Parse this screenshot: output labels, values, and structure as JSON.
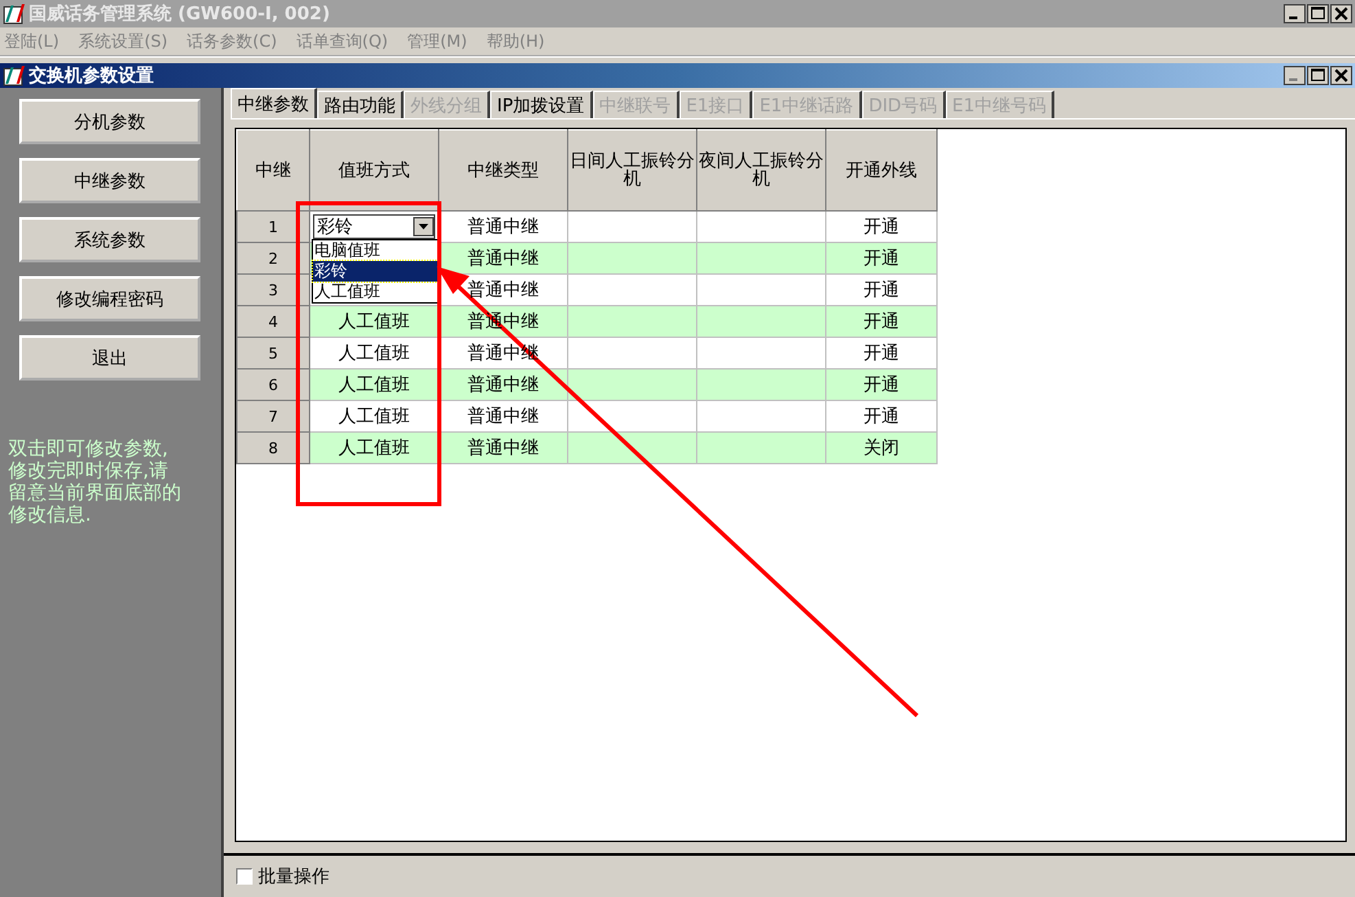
{
  "window": {
    "title": "国威话务管理系统 (GW600-I, 002)"
  },
  "menu": [
    "登陆(L)",
    "系统设置(S)",
    "话务参数(C)",
    "话单查询(Q)",
    "管理(M)",
    "帮助(H)"
  ],
  "child_window": {
    "title": "交换机参数设置"
  },
  "sidebar": {
    "buttons": [
      "分机参数",
      "中继参数",
      "系统参数",
      "修改编程密码",
      "退出"
    ],
    "help_lines": [
      "双击即可修改参数,",
      "修改完即时保存,请",
      "留意当前界面底部的",
      "修改信息."
    ]
  },
  "tabs": [
    {
      "label": "中继参数",
      "selected": true,
      "disabled": false
    },
    {
      "label": "路由功能",
      "selected": false,
      "disabled": false
    },
    {
      "label": "外线分组",
      "selected": false,
      "disabled": true
    },
    {
      "label": "IP加拨设置",
      "selected": false,
      "disabled": false
    },
    {
      "label": "中继联号",
      "selected": false,
      "disabled": true
    },
    {
      "label": "E1接口",
      "selected": false,
      "disabled": true
    },
    {
      "label": "E1中继话路",
      "selected": false,
      "disabled": true
    },
    {
      "label": "DID号码",
      "selected": false,
      "disabled": true
    },
    {
      "label": "E1中继号码",
      "selected": false,
      "disabled": true
    }
  ],
  "table": {
    "columns": [
      "中继",
      "值班方式",
      "中继类型",
      "日间人工振铃分机",
      "夜间人工振铃分机",
      "开通外线"
    ],
    "rows": [
      {
        "trunk": "1",
        "duty": "彩铃",
        "type": "普通中继",
        "outside": "开通"
      },
      {
        "trunk": "2",
        "type": "普通中继",
        "outside": "开通"
      },
      {
        "trunk": "3",
        "type": "普通中继",
        "outside": "开通"
      },
      {
        "trunk": "4",
        "duty": "人工值班",
        "type": "普通中继",
        "outside": "开通"
      },
      {
        "trunk": "5",
        "duty": "人工值班",
        "type": "普通中继",
        "outside": "开通"
      },
      {
        "trunk": "6",
        "duty": "人工值班",
        "type": "普通中继",
        "outside": "开通"
      },
      {
        "trunk": "7",
        "duty": "人工值班",
        "type": "普通中继",
        "outside": "开通"
      },
      {
        "trunk": "8",
        "duty": "人工值班",
        "type": "普通中继",
        "outside": "关闭"
      }
    ]
  },
  "dropdown": {
    "options": [
      {
        "label": "电脑值班",
        "selected": false
      },
      {
        "label": "彩铃",
        "selected": true
      },
      {
        "label": "人工值班",
        "selected": false
      }
    ]
  },
  "batch_checkbox": {
    "label": "批量操作",
    "checked": false
  }
}
